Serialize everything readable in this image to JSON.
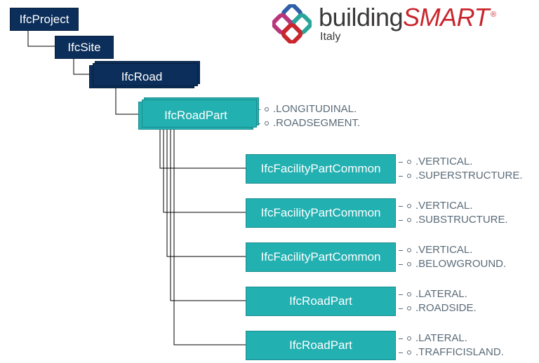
{
  "logo": {
    "word_part1": "building",
    "word_part2": "SMART",
    "sub": "Italy",
    "reg": "®"
  },
  "nodes": {
    "project": "IfcProject",
    "site": "IfcSite",
    "road": "IfcRoad",
    "roadpart_main": "IfcRoadPart"
  },
  "children": [
    {
      "label": "IfcFacilityPartCommon",
      "a": [
        ".VERTICAL.",
        ".SUPERSTRUCTURE."
      ]
    },
    {
      "label": "IfcFacilityPartCommon",
      "a": [
        ".VERTICAL.",
        ".SUBSTRUCTURE."
      ]
    },
    {
      "label": "IfcFacilityPartCommon",
      "a": [
        ".VERTICAL.",
        ".BELOWGROUND."
      ]
    },
    {
      "label": "IfcRoadPart",
      "a": [
        ".LATERAL.",
        ".ROADSIDE."
      ]
    },
    {
      "label": "IfcRoadPart",
      "a": [
        ".LATERAL.",
        ".TRAFFICISLAND."
      ]
    }
  ],
  "main_annot": [
    ".LONGITUDINAL.",
    ".ROADSEGMENT."
  ]
}
